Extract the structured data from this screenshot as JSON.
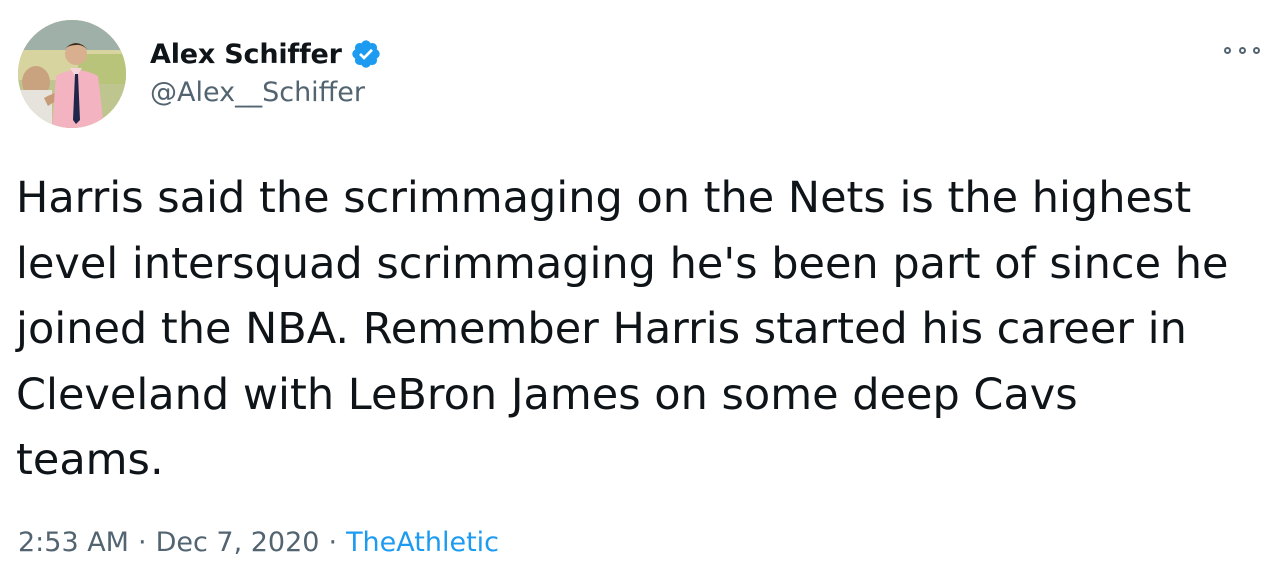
{
  "author": {
    "display_name": "Alex Schiffer",
    "handle": "@Alex__Schiffer",
    "verified": true,
    "avatar_icon": "profile-photo",
    "verified_icon": "verified-badge-icon"
  },
  "tweet": {
    "lines": [
      "Harris said the scrimmaging on the Nets is the highest",
      "level intersquad scrimmaging he's been part of since he",
      "joined the NBA. Remember Harris started his career in",
      "Cleveland with LeBron James on some deep Cavs",
      "teams."
    ]
  },
  "meta": {
    "time": "2:53 AM",
    "separator": "·",
    "date": "Dec 7, 2020",
    "source": "TheAthletic"
  },
  "menu": {
    "icon": "more-options-icon"
  },
  "colors": {
    "text_primary": "#0f1419",
    "text_secondary": "#536471",
    "accent": "#1d9bf0"
  }
}
